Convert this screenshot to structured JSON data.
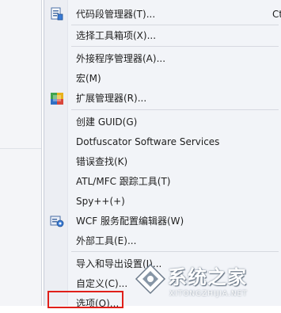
{
  "menu": {
    "items": [
      {
        "label": "代码段管理器(T)...",
        "shortcut": "Ct",
        "icon": "snippet-manager-icon"
      },
      {
        "label": "选择工具箱项(X)..."
      },
      {
        "label": "外接程序管理器(A)..."
      },
      {
        "label": "宏(M)"
      },
      {
        "label": "扩展管理器(R)...",
        "icon": "extension-manager-icon"
      },
      {
        "label": "创建 GUID(G)"
      },
      {
        "label": "Dotfuscator Software Services"
      },
      {
        "label": "错误查找(K)"
      },
      {
        "label": "ATL/MFC 跟踪工具(T)"
      },
      {
        "label": "Spy++(+)"
      },
      {
        "label": "WCF 服务配置编辑器(W)",
        "icon": "wcf-config-icon"
      },
      {
        "label": "外部工具(E)..."
      },
      {
        "label": "导入和导出设置(I)..."
      },
      {
        "label": "自定义(C)..."
      },
      {
        "label": "选项(O)..."
      }
    ]
  },
  "watermark": {
    "text": "系统之家",
    "subtext": "XITONGZHIJIA.NET"
  },
  "colors": {
    "highlight_border": "#e0201a",
    "menu_background": "#f2f4f8"
  }
}
